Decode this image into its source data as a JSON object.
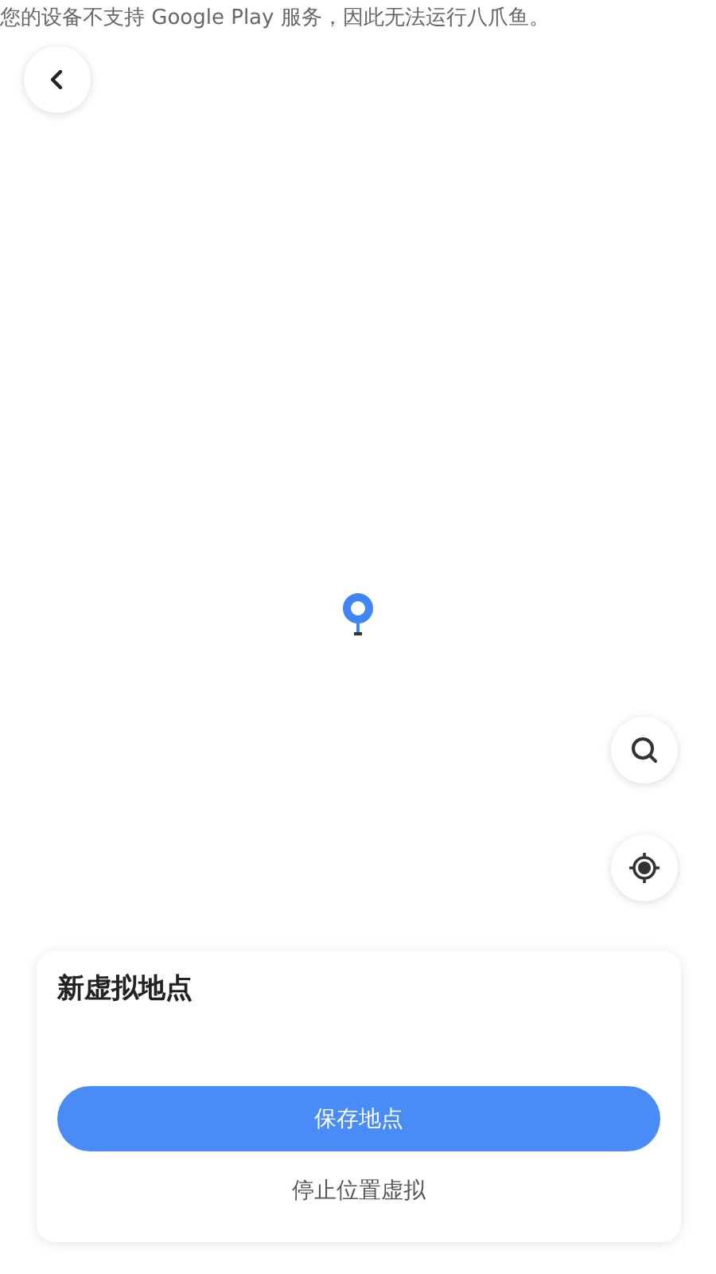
{
  "notice": "您的设备不支持 Google Play 服务，因此无法运行八爪鱼。",
  "sheet": {
    "title": "新虚拟地点",
    "primary_button": "保存地点",
    "secondary_button": "停止位置虚拟"
  }
}
